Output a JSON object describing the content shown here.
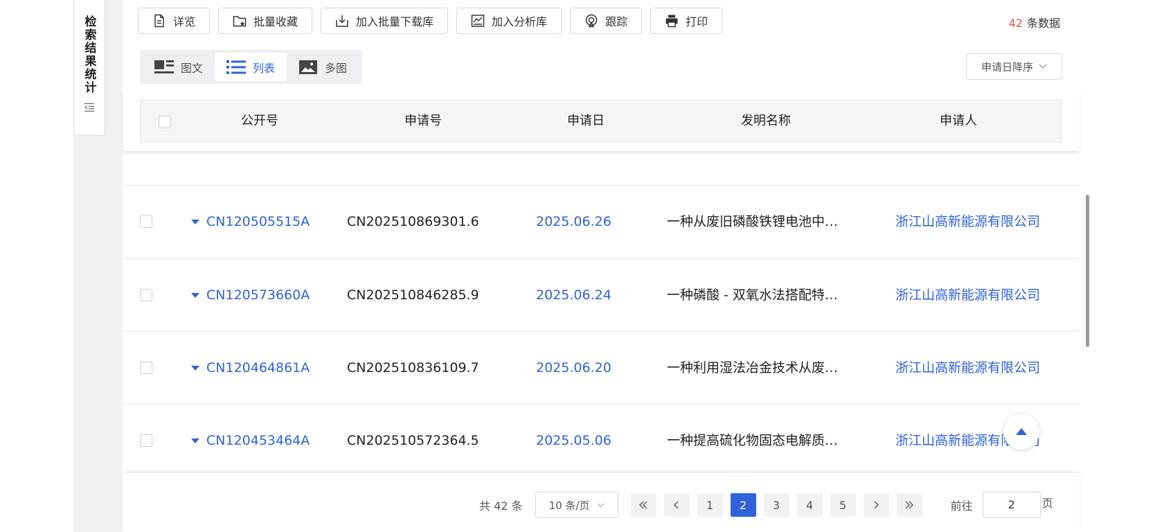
{
  "sidebar": {
    "stats_tab_label": "检索结果统计"
  },
  "toolbar": {
    "buttons": [
      {
        "label": "详览",
        "icon": "document-icon"
      },
      {
        "label": "批量收藏",
        "icon": "folder-star-icon"
      },
      {
        "label": "加入批量下载库",
        "icon": "download-box-icon"
      },
      {
        "label": "加入分析库",
        "icon": "analysis-icon"
      },
      {
        "label": "跟踪",
        "icon": "tracking-icon"
      },
      {
        "label": "打印",
        "icon": "printer-icon"
      }
    ],
    "count_number": "42",
    "count_suffix": "条数据"
  },
  "view_tabs": [
    {
      "label": "图文",
      "active": false
    },
    {
      "label": "列表",
      "active": true
    },
    {
      "label": "多图",
      "active": false
    }
  ],
  "sort": {
    "selected": "申请日降序"
  },
  "table": {
    "headers": [
      "公开号",
      "申请号",
      "申请日",
      "发明名称",
      "申请人"
    ],
    "rows": [
      {
        "pub_no": "CN120505515A",
        "app_no": "CN202510869301.6",
        "app_date": "2025.06.26",
        "title": "一种从废旧磷酸铁锂电池中…",
        "applicant": "浙江山高新能源有限公司"
      },
      {
        "pub_no": "CN120573660A",
        "app_no": "CN202510846285.9",
        "app_date": "2025.06.24",
        "title": "一种磷酸 - 双氧水法搭配特…",
        "applicant": "浙江山高新能源有限公司"
      },
      {
        "pub_no": "CN120464861A",
        "app_no": "CN202510836109.7",
        "app_date": "2025.06.20",
        "title": "一种利用湿法冶金技术从废…",
        "applicant": "浙江山高新能源有限公司"
      },
      {
        "pub_no": "CN120453464A",
        "app_no": "CN202510572364.5",
        "app_date": "2025.05.06",
        "title": "一种提高硫化物固态电解质…",
        "applicant": "浙江山高新能源有限公司"
      }
    ]
  },
  "pagination": {
    "total": "共 42 条",
    "page_size": "10 条/页",
    "pages": [
      "1",
      "2",
      "3",
      "4",
      "5"
    ],
    "current_page": "2",
    "goto_label": "前往",
    "goto_value": "2",
    "page_unit": "页"
  },
  "colors": {
    "accent": "#2e62d9",
    "count": "#e5534b"
  }
}
